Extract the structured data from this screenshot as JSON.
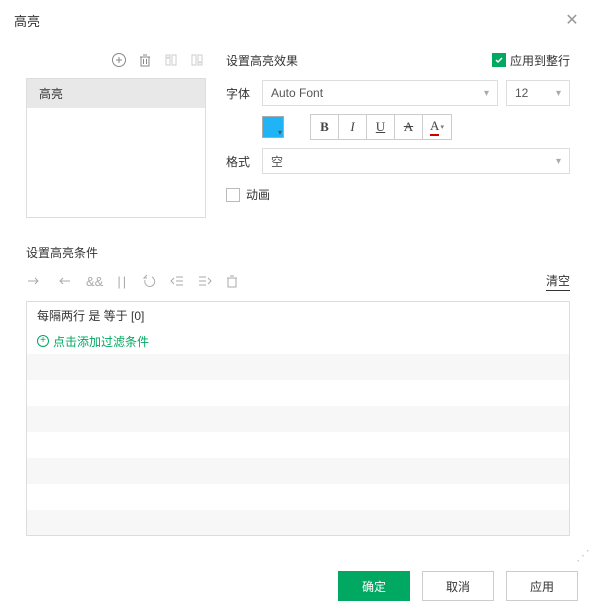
{
  "header": {
    "title": "高亮"
  },
  "left": {
    "items": [
      "高亮"
    ]
  },
  "effect": {
    "title": "设置高亮效果",
    "apply_row": "应用到整行",
    "font_label": "字体",
    "font_value": "Auto Font",
    "size_value": "12",
    "format_label": "格式",
    "format_value": "空",
    "anim_label": "动画",
    "color": "#1fb4f5"
  },
  "condition": {
    "title": "设置高亮条件",
    "clear": "清空",
    "rows": [
      "每隔两行 是 等于 [0]"
    ],
    "add_filter": "点击添加过滤条件"
  },
  "footer": {
    "ok": "确定",
    "cancel": "取消",
    "apply": "应用"
  }
}
